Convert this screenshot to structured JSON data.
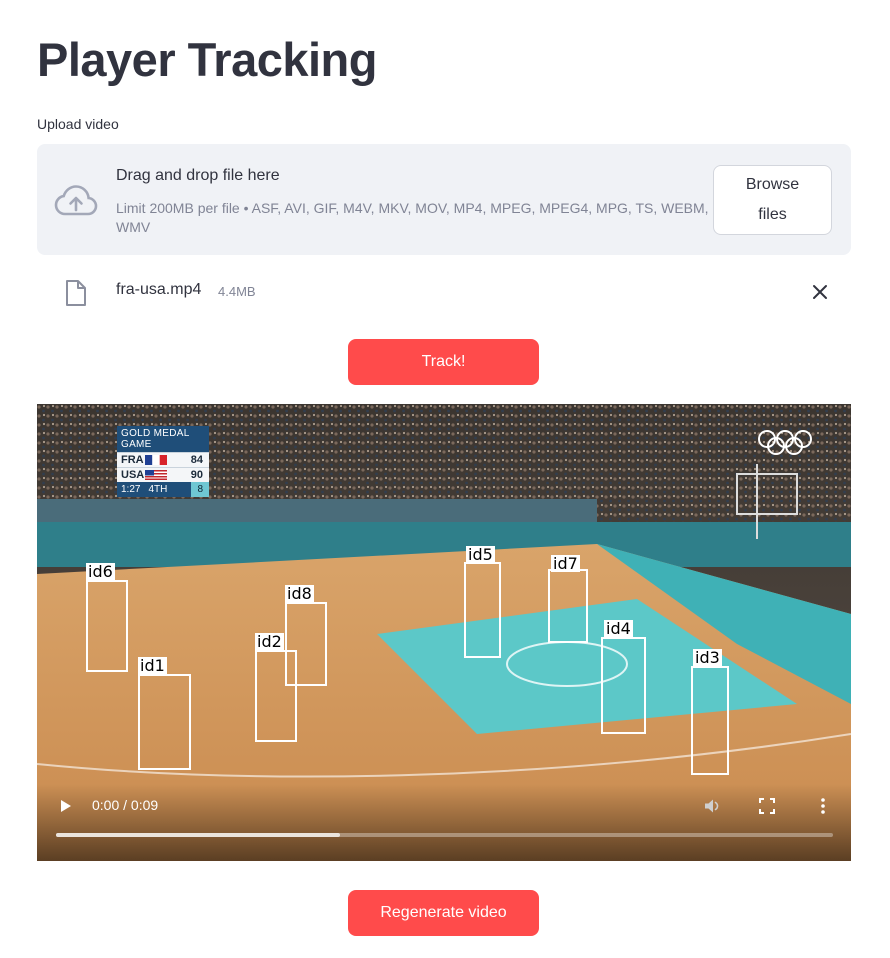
{
  "page": {
    "title": "Player Tracking"
  },
  "uploader": {
    "label": "Upload video",
    "drop_title": "Drag and drop file here",
    "limit_text": "Limit 200MB per file • ASF, AVI, GIF, M4V, MKV, MOV, MP4, MPEG, MPEG4, MPG, TS, WEBM, WMV",
    "browse_label_line1": "Browse",
    "browse_label_line2": "files",
    "icon": "cloud-upload-icon"
  },
  "file": {
    "name": "fra-usa.mp4",
    "size": "4.4MB",
    "icon": "file-icon",
    "remove_icon": "close-icon"
  },
  "buttons": {
    "track": "Track!",
    "regenerate": "Regenerate video"
  },
  "colors": {
    "primary": "#ff4b4b",
    "dropzone_bg": "#f0f2f6",
    "text": "#31333f",
    "muted": "#808495"
  },
  "video": {
    "scoreboard": {
      "header": "GOLD MEDAL GAME",
      "team1": "FRA",
      "score1": "84",
      "team2": "USA",
      "score2": "90",
      "clock": "1:27",
      "period": "4TH",
      "fouls": "8"
    },
    "player_labels": {
      "id6": "id6",
      "id1": "id1",
      "id2": "id2",
      "id8": "id8",
      "id5": "id5",
      "id7": "id7",
      "id4": "id4",
      "id3": "id3"
    },
    "time": "0:00 / 0:09",
    "progress": 0.365
  }
}
